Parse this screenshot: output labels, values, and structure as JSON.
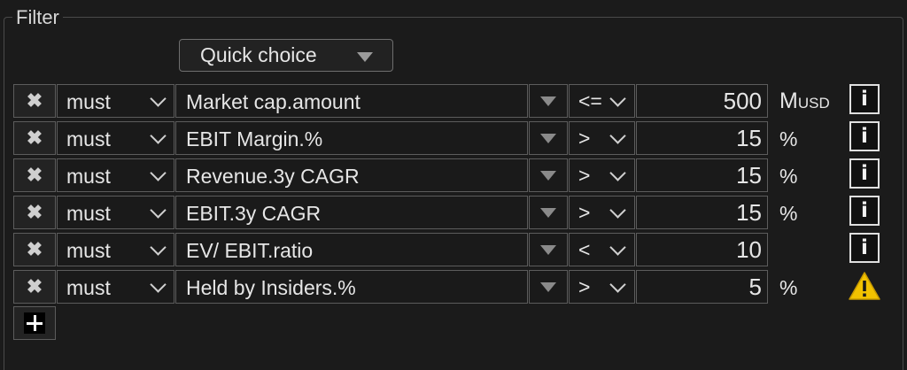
{
  "filter": {
    "legend": "Filter",
    "quick_choice_label": "Quick choice",
    "rows": [
      {
        "delete_glyph": "✖",
        "mode": "must",
        "field": "Market cap.amount",
        "operator": "<=",
        "value": "500",
        "unit_main": "M",
        "unit_sub": "USD",
        "status_icon": "info-icon"
      },
      {
        "delete_glyph": "✖",
        "mode": "must",
        "field": "EBIT Margin.%",
        "operator": ">",
        "value": "15",
        "unit_main": "%",
        "unit_sub": "",
        "status_icon": "info-icon"
      },
      {
        "delete_glyph": "✖",
        "mode": "must",
        "field": "Revenue.3y CAGR",
        "operator": ">",
        "value": "15",
        "unit_main": "%",
        "unit_sub": "",
        "status_icon": "info-icon"
      },
      {
        "delete_glyph": "✖",
        "mode": "must",
        "field": "EBIT.3y CAGR",
        "operator": ">",
        "value": "15",
        "unit_main": "%",
        "unit_sub": "",
        "status_icon": "info-icon"
      },
      {
        "delete_glyph": "✖",
        "mode": "must",
        "field": "EV/ EBIT.ratio",
        "operator": "<",
        "value": "10",
        "unit_main": "",
        "unit_sub": "",
        "status_icon": "info-icon"
      },
      {
        "delete_glyph": "✖",
        "mode": "must",
        "field": "Held by Insiders.%",
        "operator": ">",
        "value": "5",
        "unit_main": "%",
        "unit_sub": "",
        "status_icon": "warning-icon"
      }
    ],
    "info_glyph": "i",
    "add_icon": "plus-icon"
  },
  "colors": {
    "background": "#1b1b1b",
    "border": "#5c5c5c",
    "text": "#e6e6e6",
    "warning_yellow": "#f2c200"
  }
}
